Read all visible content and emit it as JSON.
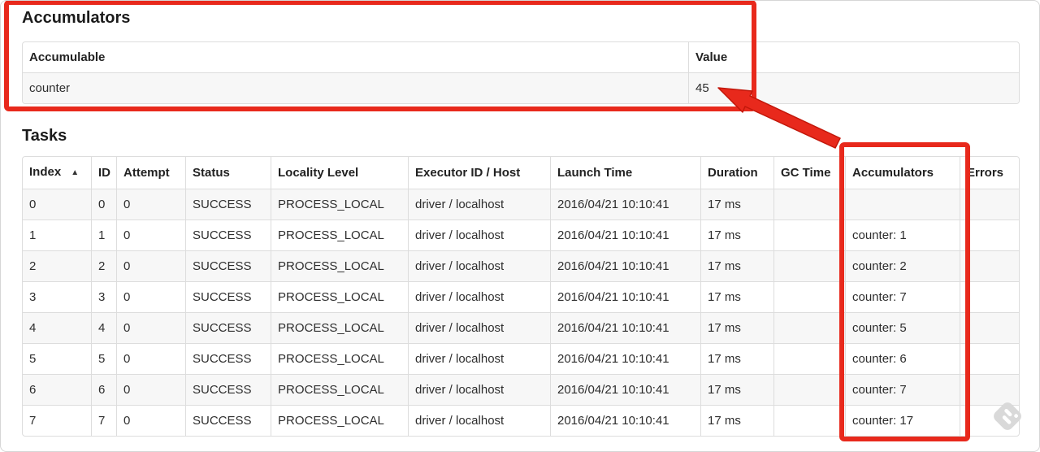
{
  "accumulators_section": {
    "title": "Accumulators",
    "table": {
      "headers": {
        "accumulable": "Accumulable",
        "value": "Value"
      },
      "rows": [
        {
          "accumulable": "counter",
          "value": "45"
        }
      ]
    }
  },
  "tasks_section": {
    "title": "Tasks",
    "table": {
      "headers": {
        "index": "Index",
        "id": "ID",
        "attempt": "Attempt",
        "status": "Status",
        "locality_level": "Locality Level",
        "executor_id_host": "Executor ID / Host",
        "launch_time": "Launch Time",
        "duration": "Duration",
        "gc_time": "GC Time",
        "accumulators": "Accumulators",
        "errors": "Errors"
      },
      "sort": {
        "column": "Index",
        "direction": "asc",
        "icon": "▲"
      },
      "rows": [
        {
          "index": "0",
          "id": "0",
          "attempt": "0",
          "status": "SUCCESS",
          "locality_level": "PROCESS_LOCAL",
          "executor_id_host": "driver / localhost",
          "launch_time": "2016/04/21 10:10:41",
          "duration": "17 ms",
          "gc_time": "",
          "accumulators": "",
          "errors": ""
        },
        {
          "index": "1",
          "id": "1",
          "attempt": "0",
          "status": "SUCCESS",
          "locality_level": "PROCESS_LOCAL",
          "executor_id_host": "driver / localhost",
          "launch_time": "2016/04/21 10:10:41",
          "duration": "17 ms",
          "gc_time": "",
          "accumulators": "counter: 1",
          "errors": ""
        },
        {
          "index": "2",
          "id": "2",
          "attempt": "0",
          "status": "SUCCESS",
          "locality_level": "PROCESS_LOCAL",
          "executor_id_host": "driver / localhost",
          "launch_time": "2016/04/21 10:10:41",
          "duration": "17 ms",
          "gc_time": "",
          "accumulators": "counter: 2",
          "errors": ""
        },
        {
          "index": "3",
          "id": "3",
          "attempt": "0",
          "status": "SUCCESS",
          "locality_level": "PROCESS_LOCAL",
          "executor_id_host": "driver / localhost",
          "launch_time": "2016/04/21 10:10:41",
          "duration": "17 ms",
          "gc_time": "",
          "accumulators": "counter: 7",
          "errors": ""
        },
        {
          "index": "4",
          "id": "4",
          "attempt": "0",
          "status": "SUCCESS",
          "locality_level": "PROCESS_LOCAL",
          "executor_id_host": "driver / localhost",
          "launch_time": "2016/04/21 10:10:41",
          "duration": "17 ms",
          "gc_time": "",
          "accumulators": "counter: 5",
          "errors": ""
        },
        {
          "index": "5",
          "id": "5",
          "attempt": "0",
          "status": "SUCCESS",
          "locality_level": "PROCESS_LOCAL",
          "executor_id_host": "driver / localhost",
          "launch_time": "2016/04/21 10:10:41",
          "duration": "17 ms",
          "gc_time": "",
          "accumulators": "counter: 6",
          "errors": ""
        },
        {
          "index": "6",
          "id": "6",
          "attempt": "0",
          "status": "SUCCESS",
          "locality_level": "PROCESS_LOCAL",
          "executor_id_host": "driver / localhost",
          "launch_time": "2016/04/21 10:10:41",
          "duration": "17 ms",
          "gc_time": "",
          "accumulators": "counter: 7",
          "errors": ""
        },
        {
          "index": "7",
          "id": "7",
          "attempt": "0",
          "status": "SUCCESS",
          "locality_level": "PROCESS_LOCAL",
          "executor_id_host": "driver / localhost",
          "launch_time": "2016/04/21 10:10:41",
          "duration": "17 ms",
          "gc_time": "",
          "accumulators": "counter: 17",
          "errors": ""
        }
      ]
    }
  },
  "annotations": {
    "highlight_color": "#e8291c",
    "highlight_border_color": "#c2170a",
    "watermark_color": "#d9d9d9",
    "boxes": [
      {
        "name": "accumulators-section-highlight"
      },
      {
        "name": "accumulators-column-highlight"
      }
    ],
    "arrow": {
      "name": "arrow-to-accumulator-value",
      "points_at": "45"
    }
  }
}
